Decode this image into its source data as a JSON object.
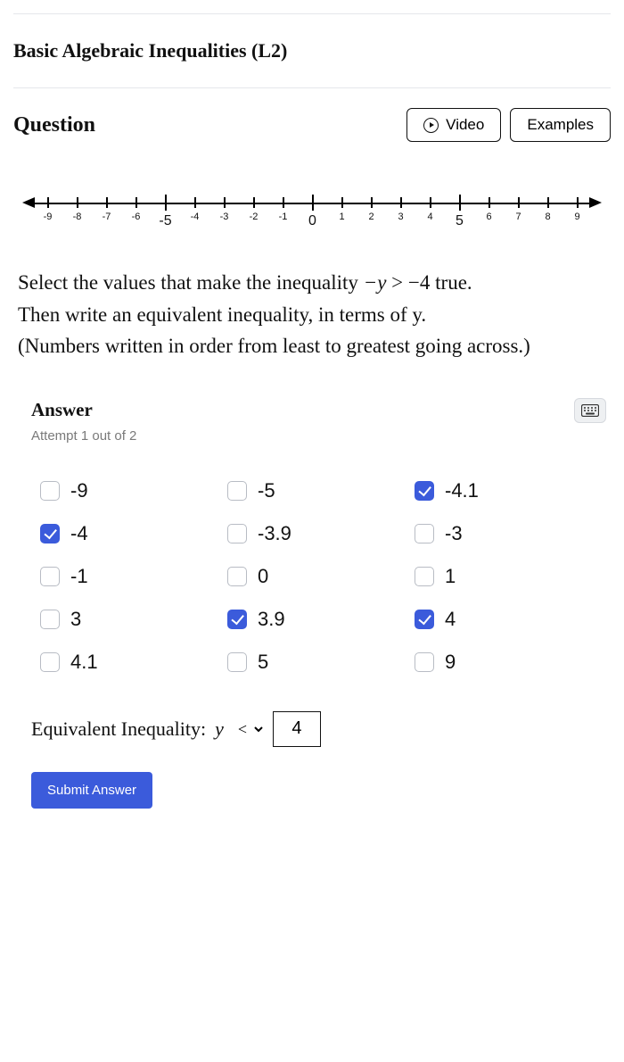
{
  "lesson_title": "Basic Algebraic Inequalities (L2)",
  "header": {
    "question_label": "Question",
    "video_label": "Video",
    "examples_label": "Examples"
  },
  "numberline": {
    "min": -9,
    "max": 9,
    "big_ticks": [
      -5,
      0,
      5
    ]
  },
  "prompt": {
    "line1_a": "Select the values that make the inequality ",
    "expr_lhs": "−y",
    "expr_op": ">",
    "expr_rhs": "−4",
    "line1_b": " true.",
    "line2": "Then write an equivalent inequality, in terms of y.",
    "line3": "(Numbers written in order from least to greatest going across.)"
  },
  "answer": {
    "label": "Answer",
    "attempt": "Attempt 1 out of 2"
  },
  "choices": [
    {
      "label": "-9",
      "checked": false
    },
    {
      "label": "-5",
      "checked": false
    },
    {
      "label": "-4.1",
      "checked": true
    },
    {
      "label": "-4",
      "checked": true
    },
    {
      "label": "-3.9",
      "checked": false
    },
    {
      "label": "-3",
      "checked": false
    },
    {
      "label": "-1",
      "checked": false
    },
    {
      "label": "0",
      "checked": false
    },
    {
      "label": "1",
      "checked": false
    },
    {
      "label": "3",
      "checked": false
    },
    {
      "label": "3.9",
      "checked": true
    },
    {
      "label": "4",
      "checked": true
    },
    {
      "label": "4.1",
      "checked": false
    },
    {
      "label": "5",
      "checked": false
    },
    {
      "label": "9",
      "checked": false
    }
  ],
  "equivalent": {
    "label": "Equivalent Inequality:",
    "variable": "y",
    "operator_options": [
      "<",
      ">",
      "≤",
      "≥",
      "="
    ],
    "operator_selected": "<",
    "value": "4"
  },
  "submit_label": "Submit Answer"
}
